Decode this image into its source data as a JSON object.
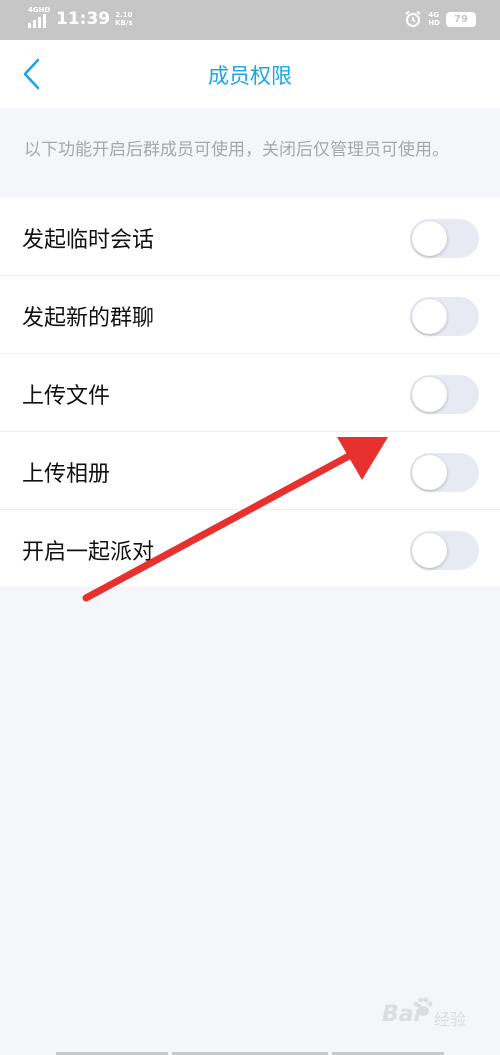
{
  "status_bar": {
    "signal_label": "4GHD",
    "time": "11:39",
    "speed_value": "2.10",
    "speed_unit": "KB/s",
    "network": "4G",
    "network_sub": "HD",
    "battery": "79",
    "alarm_icon": "alarm-clock-icon"
  },
  "header": {
    "title": "成员权限",
    "back_icon": "chevron-left-icon",
    "accent_color": "#17a7e8"
  },
  "description": "以下功能开启后群成员可使用，关闭后仅管理员可使用。",
  "settings": [
    {
      "label": "发起临时会话",
      "enabled": false
    },
    {
      "label": "发起新的群聊",
      "enabled": false
    },
    {
      "label": "上传文件",
      "enabled": false
    },
    {
      "label": "上传相册",
      "enabled": false
    },
    {
      "label": "开启一起派对",
      "enabled": false
    }
  ],
  "watermark": {
    "logo": "Bai",
    "text": "经验"
  },
  "annotation": {
    "arrow_color": "#e8312f"
  }
}
